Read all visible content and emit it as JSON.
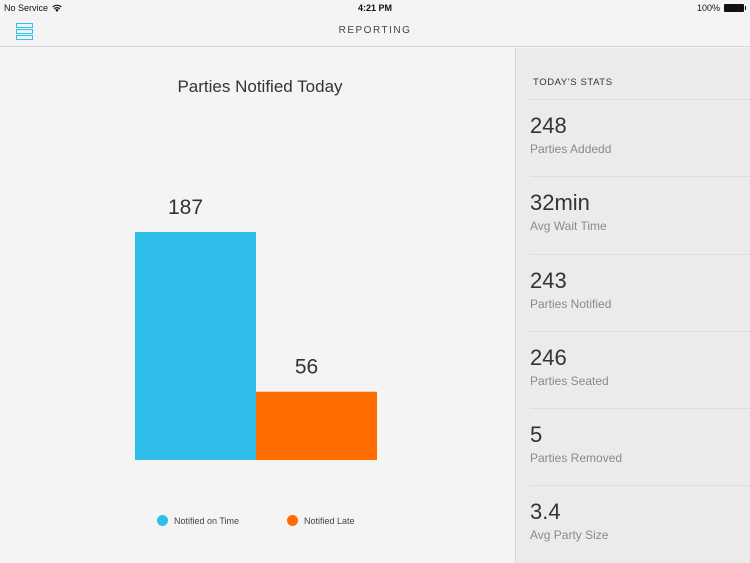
{
  "status_bar": {
    "carrier": "No Service",
    "wifi_icon": "wifi-icon",
    "time": "4:21 PM",
    "battery_percent": "100%",
    "battery_icon": "battery-icon"
  },
  "navbar": {
    "menu_icon": "menu-icon",
    "title": "REPORTING"
  },
  "colors": {
    "on_time": "#2fbde9",
    "late": "#ff6d00",
    "accent": "#36bde8"
  },
  "chart_data": {
    "type": "bar",
    "title": "Parties Notified Today",
    "categories": [
      "Notified on Time",
      "Notified Late"
    ],
    "values": [
      187,
      56
    ],
    "data_labels": [
      "187",
      "56"
    ],
    "colors": [
      "#2fbde9",
      "#ff6d00"
    ],
    "xlabel": "",
    "ylabel": "",
    "ylim": [
      0,
      187
    ],
    "grid": false,
    "legend": {
      "position": "bottom",
      "entries": [
        "Notified on Time",
        "Notified Late"
      ]
    }
  },
  "sidebar": {
    "header": "TODAY'S STATS",
    "stats": [
      {
        "value": "248",
        "label": "Parties Addedd"
      },
      {
        "value": "32min",
        "label": "Avg Wait Time"
      },
      {
        "value": "243",
        "label": "Parties Notified"
      },
      {
        "value": "246",
        "label": "Parties Seated"
      },
      {
        "value": "5",
        "label": "Parties Removed"
      },
      {
        "value": "3.4",
        "label": "Avg Party Size"
      }
    ]
  }
}
